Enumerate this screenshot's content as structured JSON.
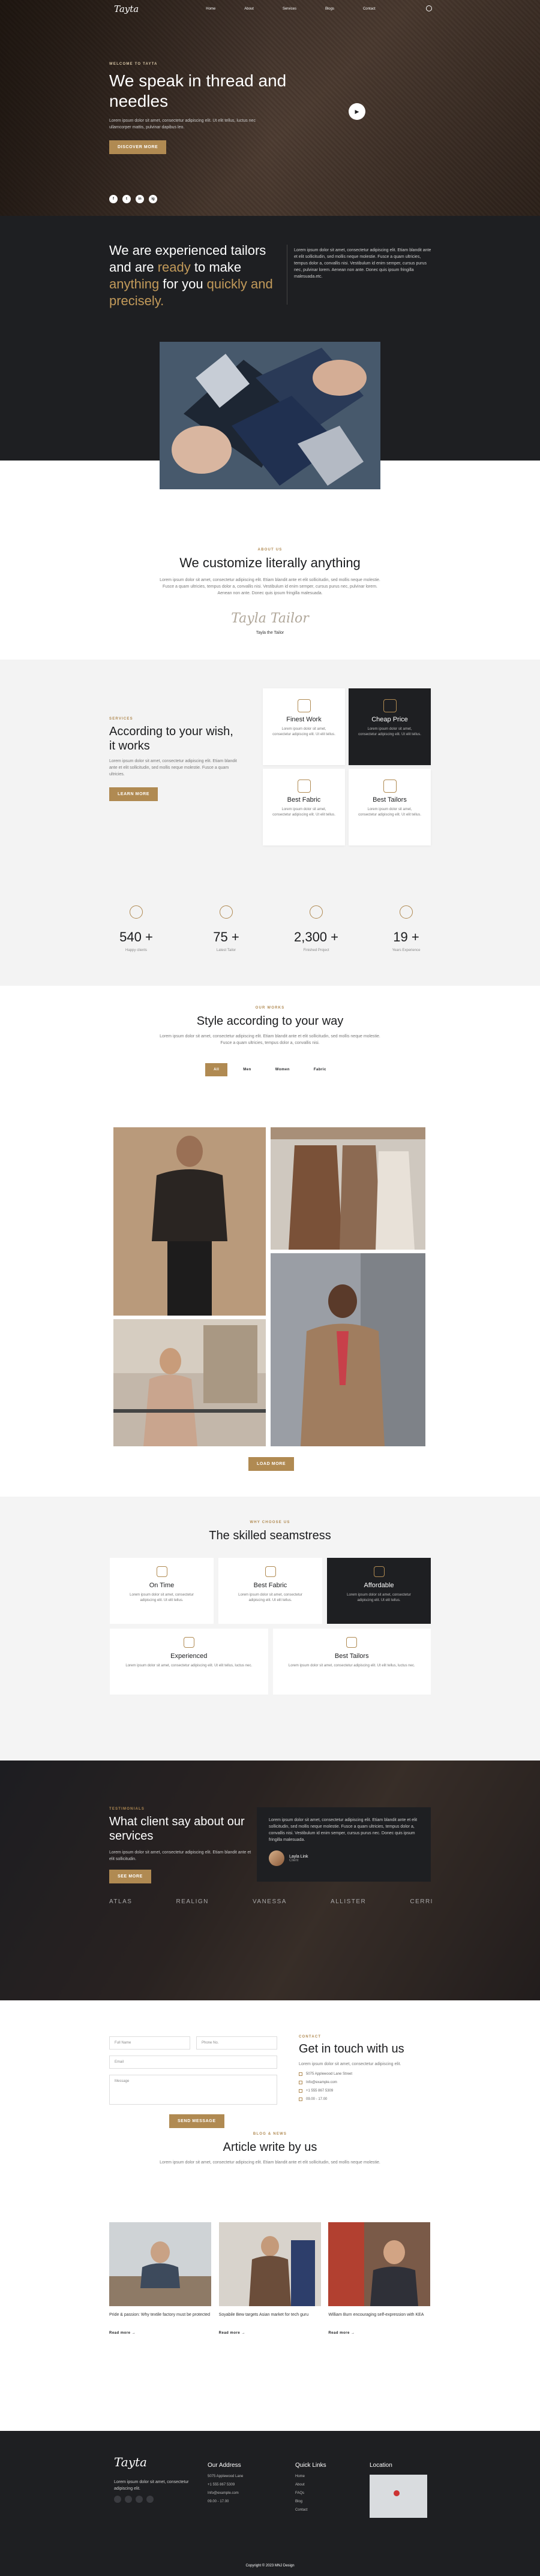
{
  "nav": {
    "logo": "Tayta",
    "links": [
      "Home",
      "About",
      "Services",
      "Blogs",
      "Contact"
    ]
  },
  "hero": {
    "eyebrow": "Welcome to Tayta",
    "title": "We speak in thread and needles",
    "text": "Lorem ipsum dolor sit amet, consectetur adipiscing elit. Ut elit tellus, luctus nec ullamcorper mattis, pulvinar dapibus leo.",
    "button": "Discover more",
    "socials": [
      "f",
      "t",
      "in",
      "ig"
    ]
  },
  "tailors": {
    "h1": "We are experienced tailors",
    "h2a": "and are ",
    "h2b": "ready",
    "h2c": " to make",
    "h3a": "anything",
    "h3b": " for you ",
    "h3c": "quickly and precisely.",
    "text": "Lorem ipsum dolor sit amet, consectetur adipiscing elit. Etiam blandit ante et elit sollicitudin, sed mollis neque molestie. Fusce a quam ultricies, tempus dolor a, convallis nisi. Vestibulum id enim semper, cursus purus nec, pulvinar lorem. Aenean non ante. Donec quis ipsum fringilla malesuada.etc."
  },
  "customize": {
    "eyebrow": "About us",
    "title": "We customize literally anything",
    "text": "Lorem ipsum dolor sit amet, consectetur adipiscing elit. Etiam blandit ante et elit sollicitudin, sed mollis neque molestie. Fusce a quam ultricies, tempus dolor a, convallis nisi. Vestibulum id enim semper, cursus purus nec, pulvinar lorem. Aenean non ante. Donec quis ipsum fringilla malesuada.",
    "signature": "Tayla Tailor",
    "signer": "Tayla the Tailor"
  },
  "services": {
    "eyebrow": "Services",
    "title": "According to your wish, it works",
    "text": "Lorem ipsum dolor sit amet, consectetur adipiscing elit. Etiam blandit ante et elit sollicitudin, sed mollis neque molestie. Fusce a quam ultricies.",
    "button": "Learn more",
    "cards": [
      {
        "title": "Finest Work",
        "text": "Lorem ipsum dolor sit amet, consectetur adipiscing elit. Ut elit tellus.",
        "dark": false
      },
      {
        "title": "Cheap Price",
        "text": "Lorem ipsum dolor sit amet, consectetur adipiscing elit. Ut elit tellus.",
        "dark": true
      },
      {
        "title": "Best Fabric",
        "text": "Lorem ipsum dolor sit amet, consectetur adipiscing elit. Ut elit tellus.",
        "dark": false
      },
      {
        "title": "Best Tailors",
        "text": "Lorem ipsum dolor sit amet, consectetur adipiscing elit. Ut elit tellus.",
        "dark": false
      }
    ]
  },
  "stats": [
    {
      "value": "540 +",
      "label": "Happy clients"
    },
    {
      "value": "75 +",
      "label": "Latest Tailor"
    },
    {
      "value": "2,300 +",
      "label": "Finished Project"
    },
    {
      "value": "19 +",
      "label": "Years Experience"
    }
  ],
  "style": {
    "eyebrow": "Our works",
    "title": "Style according to your way",
    "text": "Lorem ipsum dolor sit amet, consectetur adipiscing elit. Etiam blandit ante et elit sollicitudin, sed mollis neque molestie. Fusce a quam ultricies, tempus dolor a, convallis nisi.",
    "filters": [
      "All",
      "Men",
      "Women",
      "Fabric"
    ],
    "button": "Load more"
  },
  "seam": {
    "eyebrow": "Why choose us",
    "title": "The skilled seamstress",
    "cards": [
      {
        "title": "On Time",
        "text": "Lorem ipsum dolor sit amet, consectetur adipiscing elit. Ut elit tellus.",
        "dark": false
      },
      {
        "title": "Best Fabric",
        "text": "Lorem ipsum dolor sit amet, consectetur adipiscing elit. Ut elit tellus.",
        "dark": false
      },
      {
        "title": "Affordable",
        "text": "Lorem ipsum dolor sit amet, consectetur adipiscing elit. Ut elit tellus.",
        "dark": true
      },
      {
        "title": "Experienced",
        "text": "Lorem ipsum dolor sit amet, consectetur adipiscing elit. Ut elit tellus, luctus nec.",
        "dark": false
      },
      {
        "title": "Best Tailors",
        "text": "Lorem ipsum dolor sit amet, consectetur adipiscing elit. Ut elit tellus, luctus nec.",
        "dark": false
      }
    ]
  },
  "testi": {
    "eyebrow": "Testimonials",
    "title": "What client say about our services",
    "text": "Lorem ipsum dolor sit amet, consectetur adipiscing elit. Etiam blandit ante et elit sollicitudin.",
    "button": "See more",
    "quote": "Lorem ipsum dolor sit amet, consectetur adipiscing elit. Etiam blandit ante et elit sollicitudin, sed mollis neque molestie. Fusce a quam ultricies, tempus dolor a, convallis nisi. Vestibulum id enim semper, cursus purus nec. Donec quis ipsum fringilla malesuada.",
    "author": "Layla Link",
    "role": "Client",
    "brands": [
      "ATLAS",
      "REALIGN",
      "VANESSA",
      "ALLISTER",
      "CERRI"
    ]
  },
  "contact": {
    "eyebrow": "Contact",
    "title": "Get in touch with us",
    "text": "Lorem ipsum dolor sit amet, consectetur adipiscing elit.",
    "fields": {
      "name": "Full Name",
      "phone": "Phone No.",
      "email": "Email",
      "message": "Message"
    },
    "button": "Send Message",
    "lines": [
      "5075 Applewood Lane Street",
      "Info@example.com",
      "+1 555 867 5309",
      "09.00 - 17.00"
    ]
  },
  "articles": {
    "eyebrow": "Blog & News",
    "title": "Article write by us",
    "text": "Lorem ipsum dolor sit amet, consectetur adipiscing elit. Etiam blandit ante et elit sollicitudin, sed mollis neque molestie.",
    "items": [
      {
        "title": "Pride & passion: Why textile factory must be protected",
        "more": "Read more →"
      },
      {
        "title": "Soyabile Bew targets Asian market for tech guru",
        "more": "Read more →"
      },
      {
        "title": "William Burn encouraging self-expression with KEA",
        "more": "Read more →"
      }
    ]
  },
  "footer": {
    "logo": "Tayta",
    "text": "Lorem ipsum dolor sit amet, consectetur adipiscing elit.",
    "addr_title": "Our Address",
    "addr": [
      "5075 Applewood Lane",
      "+1 555 867 5309",
      "Info@example.com",
      "09.00 - 17.00"
    ],
    "links_title": "Quick Links",
    "links": [
      "Home",
      "About",
      "FAQs",
      "Blog",
      "Contact"
    ],
    "loc_title": "Location",
    "copyright": "Copyright © 2023 MNJ Design"
  }
}
